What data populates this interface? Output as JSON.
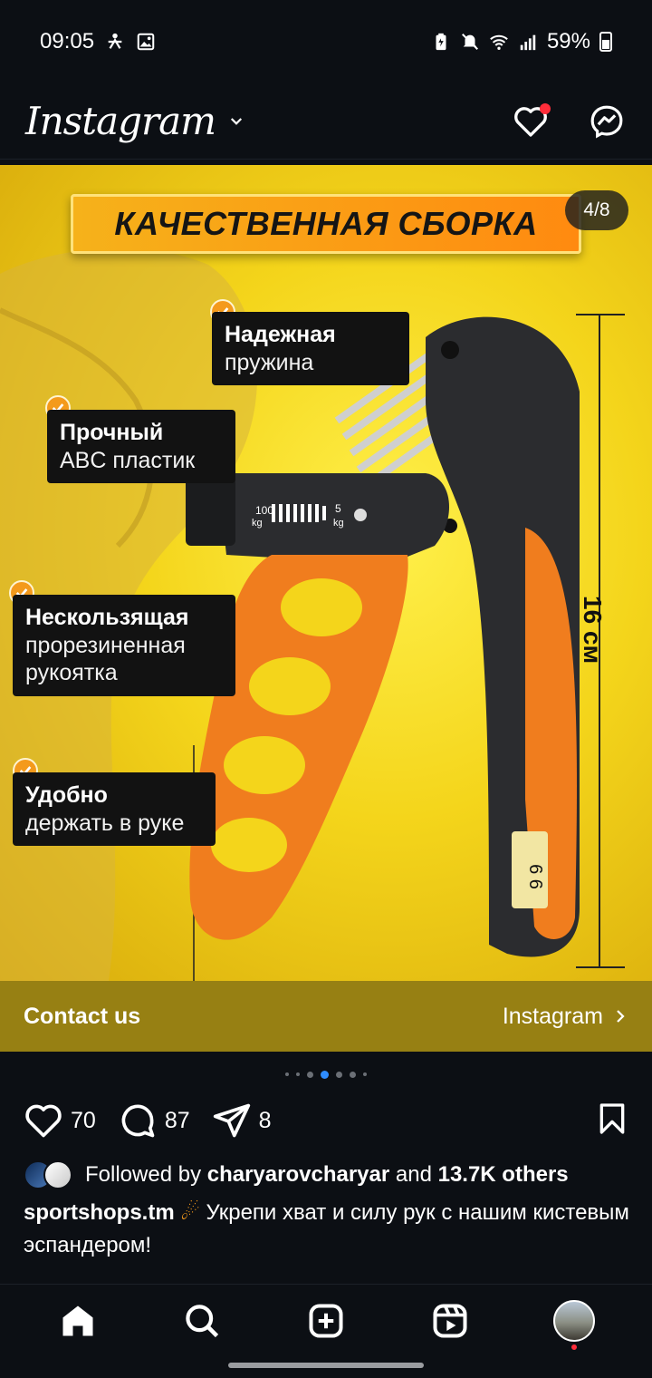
{
  "status_bar": {
    "time": "09:05",
    "battery": "59%",
    "icons": [
      "accessibility-icon",
      "gallery-icon",
      "battery-saver-icon",
      "mute-icon",
      "wifi-icon",
      "signal-icon",
      "battery-icon"
    ]
  },
  "header": {
    "logo": "Instagram",
    "icons": [
      "chevron-down-icon",
      "heart-icon",
      "messenger-icon"
    ],
    "has_notification": true
  },
  "post": {
    "image": {
      "banner": "КАЧЕСТВЕННАЯ СБОРКА",
      "counter": "4/8",
      "features": [
        {
          "title": "Надежная",
          "subtitle": "пружина"
        },
        {
          "title": "Прочный",
          "subtitle": "ABC пластик"
        },
        {
          "title": "Нескользящая",
          "subtitle": "прорезиненная рукоятка"
        },
        {
          "title": "Удобно",
          "subtitle": "держать в руке"
        }
      ],
      "dimension": "16 см",
      "scale_left": "100 kg",
      "scale_right": "5 kg",
      "colors": {
        "background": "#f4d51b",
        "accent": "#f49a1c"
      }
    },
    "contact": {
      "label": "Contact us",
      "link": "Instagram"
    },
    "carousel": {
      "total_dots": 7,
      "active_index": 2
    },
    "actions": {
      "likes": "70",
      "comments": "87",
      "shares": "8"
    },
    "followed": {
      "prefix": "Followed by",
      "user": "charyarovcharyar",
      "and": "and",
      "others": "13.7K others"
    },
    "caption": {
      "author": "sportshops.tm",
      "emoji": "☄",
      "text": "Укрепи хват и силу рук с нашим кистевым эспандером!"
    }
  },
  "nav": {
    "items": [
      "home-icon",
      "search-icon",
      "create-icon",
      "reels-icon",
      "profile-avatar"
    ]
  }
}
